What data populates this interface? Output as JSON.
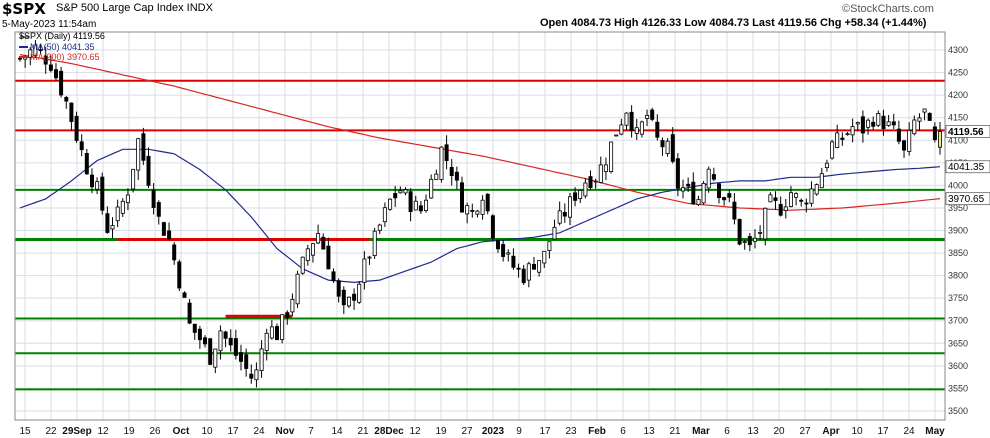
{
  "header": {
    "symbol": "$SPX",
    "description": "S&P 500 Large Cap Index  INDX",
    "datetime": "5-May-2023 11:54am",
    "watermark": "©StockCharts.com",
    "ohlc": "Open 4084.73   High 4126.33   Low 4084.73   Last 4119.56   Chg +58.34 (+1.44%)"
  },
  "legend": {
    "main": "$SPX (Daily) 4119.56",
    "ma50": "MA(50) 4041.35",
    "ma200": "MA(200) 3970.65"
  },
  "colors": {
    "up": "#ffffff",
    "down": "#000000",
    "ma50": "#1f2a8c",
    "ma200": "#d7261e",
    "resistance": "#e00000",
    "support": "#008000",
    "grid": "#d9dde6",
    "last_candle": "#f0e68c"
  },
  "chart_data": {
    "type": "candlestick",
    "ylim": [
      3480,
      4340
    ],
    "yticks": [
      3500,
      3550,
      3600,
      3650,
      3700,
      3750,
      3800,
      3850,
      3900,
      3950,
      4000,
      4050,
      4100,
      4150,
      4200,
      4250,
      4300
    ],
    "xticks": [
      {
        "label": "15",
        "bold": false
      },
      {
        "label": "22",
        "bold": false
      },
      {
        "label": "29Sep",
        "bold": true
      },
      {
        "label": "12",
        "bold": false
      },
      {
        "label": "19",
        "bold": false
      },
      {
        "label": "26",
        "bold": false
      },
      {
        "label": "Oct",
        "bold": true
      },
      {
        "label": "10",
        "bold": false
      },
      {
        "label": "17",
        "bold": false
      },
      {
        "label": "24",
        "bold": false
      },
      {
        "label": "Nov",
        "bold": true
      },
      {
        "label": "7",
        "bold": false
      },
      {
        "label": "14",
        "bold": false
      },
      {
        "label": "21",
        "bold": false
      },
      {
        "label": "28Dec",
        "bold": true
      },
      {
        "label": "12",
        "bold": false
      },
      {
        "label": "19",
        "bold": false
      },
      {
        "label": "27",
        "bold": false
      },
      {
        "label": "2023",
        "bold": true
      },
      {
        "label": "9",
        "bold": false
      },
      {
        "label": "17",
        "bold": false
      },
      {
        "label": "23",
        "bold": false
      },
      {
        "label": "Feb",
        "bold": true
      },
      {
        "label": "6",
        "bold": false
      },
      {
        "label": "13",
        "bold": false
      },
      {
        "label": "21",
        "bold": false
      },
      {
        "label": "Mar",
        "bold": true
      },
      {
        "label": "6",
        "bold": false
      },
      {
        "label": "13",
        "bold": false
      },
      {
        "label": "20",
        "bold": false
      },
      {
        "label": "27",
        "bold": false
      },
      {
        "label": "Apr",
        "bold": true
      },
      {
        "label": "10",
        "bold": false
      },
      {
        "label": "17",
        "bold": false
      },
      {
        "label": "24",
        "bold": false
      },
      {
        "label": "May",
        "bold": true
      }
    ],
    "price_labels": [
      {
        "text": "4119.56",
        "value": 4119.56,
        "bold": true
      },
      {
        "text": "4041.35",
        "value": 4041.35,
        "bold": false
      },
      {
        "text": "3970.65",
        "value": 3970.65,
        "bold": false
      }
    ],
    "support_levels": [
      3990,
      3880,
      3705,
      3628,
      3548
    ],
    "resistance_levels": [
      4232,
      4122
    ],
    "resistance_segments": [
      {
        "from": 19,
        "to": 68,
        "value": 3880
      },
      {
        "from": 40,
        "to": 53,
        "value": 3710
      }
    ],
    "sessions": 180,
    "close_path": [
      [
        0,
        4280
      ],
      [
        3,
        4305
      ],
      [
        6,
        4270
      ],
      [
        9,
        4185
      ],
      [
        11,
        4110
      ],
      [
        13,
        4040
      ],
      [
        15,
        3990
      ],
      [
        17,
        3905
      ],
      [
        19,
        3935
      ],
      [
        21,
        3990
      ],
      [
        23,
        4100
      ],
      [
        25,
        4015
      ],
      [
        27,
        3925
      ],
      [
        29,
        3880
      ],
      [
        31,
        3790
      ],
      [
        33,
        3690
      ],
      [
        35,
        3660
      ],
      [
        37,
        3620
      ],
      [
        39,
        3680
      ],
      [
        41,
        3640
      ],
      [
        43,
        3610
      ],
      [
        45,
        3575
      ],
      [
        46,
        3585
      ],
      [
        48,
        3690
      ],
      [
        50,
        3670
      ],
      [
        52,
        3720
      ],
      [
        54,
        3790
      ],
      [
        56,
        3860
      ],
      [
        58,
        3895
      ],
      [
        60,
        3830
      ],
      [
        62,
        3745
      ],
      [
        63,
        3720
      ],
      [
        65,
        3760
      ],
      [
        67,
        3820
      ],
      [
        70,
        3910
      ],
      [
        72,
        3965
      ],
      [
        74,
        3990
      ],
      [
        76,
        3960
      ],
      [
        78,
        3945
      ],
      [
        80,
        4010
      ],
      [
        82,
        4080
      ],
      [
        84,
        4035
      ],
      [
        86,
        3960
      ],
      [
        88,
        3940
      ],
      [
        90,
        3985
      ],
      [
        92,
        3900
      ],
      [
        94,
        3850
      ],
      [
        96,
        3820
      ],
      [
        98,
        3800
      ],
      [
        100,
        3830
      ],
      [
        102,
        3845
      ],
      [
        104,
        3910
      ],
      [
        106,
        3940
      ],
      [
        108,
        3980
      ],
      [
        110,
        4010
      ],
      [
        112,
        4020
      ],
      [
        114,
        4060
      ],
      [
        116,
        4120
      ],
      [
        118,
        4170
      ],
      [
        120,
        4110
      ],
      [
        122,
        4155
      ],
      [
        124,
        4100
      ],
      [
        126,
        4080
      ],
      [
        128,
        4000
      ],
      [
        130,
        3985
      ],
      [
        132,
        3970
      ],
      [
        134,
        4050
      ],
      [
        136,
        3990
      ],
      [
        138,
        3960
      ],
      [
        140,
        3880
      ],
      [
        142,
        3860
      ],
      [
        144,
        3900
      ],
      [
        146,
        3960
      ],
      [
        148,
        3950
      ],
      [
        150,
        3985
      ],
      [
        152,
        3960
      ],
      [
        154,
        3990
      ],
      [
        156,
        4030
      ],
      [
        158,
        4090
      ],
      [
        160,
        4105
      ],
      [
        162,
        4130
      ],
      [
        164,
        4125
      ],
      [
        166,
        4150
      ],
      [
        168,
        4140
      ],
      [
        170,
        4120
      ],
      [
        172,
        4070
      ],
      [
        174,
        4140
      ],
      [
        176,
        4160
      ],
      [
        178,
        4090
      ],
      [
        179,
        4119.56
      ]
    ],
    "ma50_path": [
      [
        0,
        3950
      ],
      [
        5,
        3970
      ],
      [
        10,
        4010
      ],
      [
        15,
        4055
      ],
      [
        20,
        4080
      ],
      [
        25,
        4080
      ],
      [
        30,
        4070
      ],
      [
        35,
        4035
      ],
      [
        40,
        3990
      ],
      [
        45,
        3930
      ],
      [
        50,
        3860
      ],
      [
        55,
        3815
      ],
      [
        60,
        3790
      ],
      [
        65,
        3785
      ],
      [
        70,
        3790
      ],
      [
        75,
        3810
      ],
      [
        80,
        3830
      ],
      [
        85,
        3860
      ],
      [
        90,
        3875
      ],
      [
        95,
        3880
      ],
      [
        100,
        3885
      ],
      [
        105,
        3895
      ],
      [
        110,
        3920
      ],
      [
        115,
        3945
      ],
      [
        120,
        3970
      ],
      [
        125,
        3985
      ],
      [
        130,
        3995
      ],
      [
        135,
        4005
      ],
      [
        140,
        4010
      ],
      [
        145,
        4010
      ],
      [
        150,
        4018
      ],
      [
        155,
        4018
      ],
      [
        160,
        4025
      ],
      [
        165,
        4030
      ],
      [
        170,
        4035
      ],
      [
        175,
        4038
      ],
      [
        179,
        4041.35
      ]
    ],
    "ma200_path": [
      [
        0,
        4290
      ],
      [
        10,
        4270
      ],
      [
        20,
        4245
      ],
      [
        30,
        4220
      ],
      [
        40,
        4190
      ],
      [
        50,
        4160
      ],
      [
        60,
        4130
      ],
      [
        70,
        4105
      ],
      [
        80,
        4085
      ],
      [
        90,
        4065
      ],
      [
        100,
        4040
      ],
      [
        110,
        4015
      ],
      [
        120,
        3985
      ],
      [
        130,
        3960
      ],
      [
        140,
        3950
      ],
      [
        150,
        3945
      ],
      [
        160,
        3950
      ],
      [
        170,
        3960
      ],
      [
        179,
        3970.65
      ]
    ]
  }
}
